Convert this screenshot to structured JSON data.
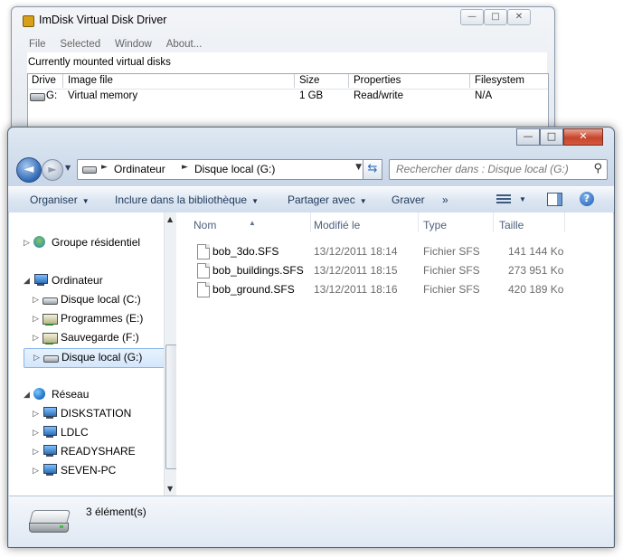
{
  "imdisk": {
    "title": "ImDisk Virtual Disk Driver",
    "menu": [
      "File",
      "Selected",
      "Window",
      "About..."
    ],
    "caption": "Currently mounted virtual disks",
    "columns": [
      "Drive",
      "Image file",
      "Size",
      "Properties",
      "Filesystem"
    ],
    "row": {
      "drive": "G:",
      "image": "Virtual memory",
      "size": "1 GB",
      "props": "Read/write",
      "fs": "N/A"
    },
    "buttons": {
      "min": "—",
      "max": "□",
      "close": "✕"
    }
  },
  "explorer": {
    "buttons": {
      "min": "—",
      "max": "□",
      "close": "✕"
    },
    "address": {
      "crumbs": [
        "Ordinateur",
        "Disque local (G:)"
      ]
    },
    "search": {
      "placeholder": "Rechercher dans : Disque local (G:)"
    },
    "commands": {
      "organize": "Organiser",
      "include": "Inclure dans la bibliothèque",
      "share": "Partager avec",
      "burn": "Graver",
      "more": "»"
    },
    "nav": {
      "homegroup": "Groupe résidentiel",
      "computer": "Ordinateur",
      "drives": [
        "Disque local (C:)",
        "Programmes (E:)",
        "Sauvegarde (F:)",
        "Disque local (G:)"
      ],
      "network": "Réseau",
      "hosts": [
        "DISKSTATION",
        "LDLC",
        "READYSHARE",
        "SEVEN-PC"
      ]
    },
    "columns": {
      "name": "Nom",
      "modified": "Modifié le",
      "type": "Type",
      "size": "Taille"
    },
    "files": [
      {
        "name": "bob_3do.SFS",
        "modified": "13/12/2011 18:14",
        "type": "Fichier SFS",
        "size": "141 144 Ko"
      },
      {
        "name": "bob_buildings.SFS",
        "modified": "13/12/2011 18:15",
        "type": "Fichier SFS",
        "size": "273 951 Ko"
      },
      {
        "name": "bob_ground.SFS",
        "modified": "13/12/2011 18:16",
        "type": "Fichier SFS",
        "size": "420 189 Ko"
      }
    ],
    "status": {
      "count": "3 élément(s)"
    }
  }
}
